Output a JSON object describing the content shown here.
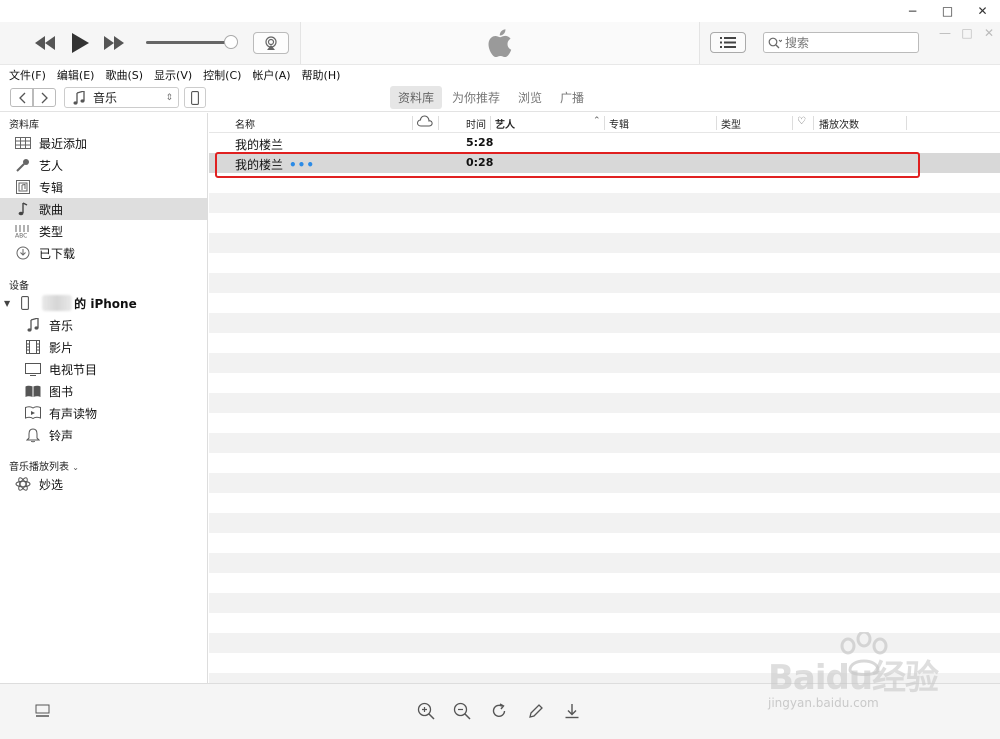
{
  "window": {
    "minimize": "−",
    "maximize": "□",
    "close": "✕"
  },
  "player": {
    "search_placeholder": "搜索",
    "volume_percent": 90
  },
  "menu": [
    "文件(F)",
    "编辑(E)",
    "歌曲(S)",
    "显示(V)",
    "控制(C)",
    "帐户(A)",
    "帮助(H)"
  ],
  "nav": {
    "back": "<",
    "forward": ">",
    "media_type": "音乐",
    "tabs": [
      {
        "label": "资料库",
        "active": true
      },
      {
        "label": "为你推荐",
        "active": false
      },
      {
        "label": "浏览",
        "active": false
      },
      {
        "label": "广播",
        "active": false
      }
    ]
  },
  "sidebar": {
    "library_title": "资料库",
    "library": [
      {
        "label": "最近添加",
        "icon": "grid-icon"
      },
      {
        "label": "艺人",
        "icon": "microphone-icon"
      },
      {
        "label": "专辑",
        "icon": "album-icon"
      },
      {
        "label": "歌曲",
        "icon": "music-note-icon",
        "selected": true
      },
      {
        "label": "类型",
        "icon": "genre-icon"
      },
      {
        "label": "已下载",
        "icon": "download-clock-icon"
      }
    ],
    "devices_title": "设备",
    "device_name": "的 iPhone",
    "device_items": [
      {
        "label": "音乐",
        "icon": "music-note-icon"
      },
      {
        "label": "影片",
        "icon": "film-icon"
      },
      {
        "label": "电视节目",
        "icon": "tv-icon"
      },
      {
        "label": "图书",
        "icon": "book-icon"
      },
      {
        "label": "有声读物",
        "icon": "audiobook-icon"
      },
      {
        "label": "铃声",
        "icon": "bell-icon"
      }
    ],
    "playlists_title": "音乐播放列表",
    "playlists": [
      {
        "label": "妙选",
        "icon": "atom-icon"
      }
    ]
  },
  "columns": {
    "name": "名称",
    "time": "时间",
    "artist": "艺人",
    "album": "专辑",
    "genre": "类型",
    "plays": "播放次数"
  },
  "songs": [
    {
      "name": "我的楼兰",
      "time": "5:28",
      "selected": false
    },
    {
      "name": "我的楼兰",
      "time": "0:28",
      "selected": true,
      "status": "•••"
    }
  ],
  "watermark": {
    "brand": "Baidu经验",
    "url": "jingyan.baidu.com"
  }
}
